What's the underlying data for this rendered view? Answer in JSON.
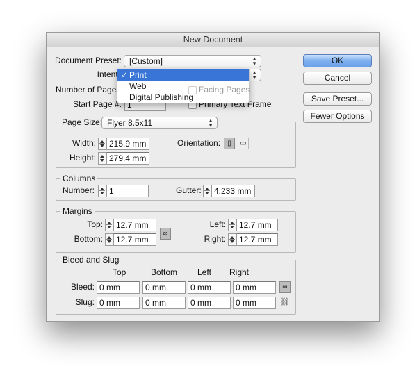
{
  "window": {
    "title": "New Document"
  },
  "preset": {
    "label": "Document Preset:",
    "value": "[Custom]"
  },
  "intent": {
    "label": "Intent:",
    "value": "Print",
    "options": [
      "Print",
      "Web",
      "Digital Publishing"
    ],
    "selected": "Print"
  },
  "pages": {
    "label": "Number of Pages:",
    "facing_label": "Facing Pages",
    "start_label": "Start Page #:",
    "start_value": "1",
    "primary_label": "Primary Text Frame",
    "facing_checked": false,
    "primary_checked": false
  },
  "page_size": {
    "legend": "Page Size:",
    "value": "Flyer 8.5x11",
    "width_label": "Width:",
    "width": "215.9 mm",
    "height_label": "Height:",
    "height": "279.4 mm",
    "orientation_label": "Orientation:",
    "orientation": "portrait"
  },
  "columns": {
    "legend": "Columns",
    "number_label": "Number:",
    "number": "1",
    "gutter_label": "Gutter:",
    "gutter": "4.233 mm"
  },
  "margins": {
    "legend": "Margins",
    "top_label": "Top:",
    "top": "12.7 mm",
    "bottom_label": "Bottom:",
    "bottom": "12.7 mm",
    "left_label": "Left:",
    "left": "12.7 mm",
    "right_label": "Right:",
    "right": "12.7 mm",
    "linked": true
  },
  "bleed_slug": {
    "legend": "Bleed and Slug",
    "headers": [
      "Top",
      "Bottom",
      "Left",
      "Right"
    ],
    "bleed_label": "Bleed:",
    "bleed": [
      "0 mm",
      "0 mm",
      "0 mm",
      "0 mm"
    ],
    "slug_label": "Slug:",
    "slug": [
      "0 mm",
      "0 mm",
      "0 mm",
      "0 mm"
    ],
    "bleed_linked": true,
    "slug_linked": false
  },
  "buttons": {
    "ok": "OK",
    "cancel": "Cancel",
    "save_preset": "Save Preset...",
    "fewer_options": "Fewer Options"
  },
  "colors": {
    "accent": "#3875d7",
    "window_bg": "#ececec"
  }
}
